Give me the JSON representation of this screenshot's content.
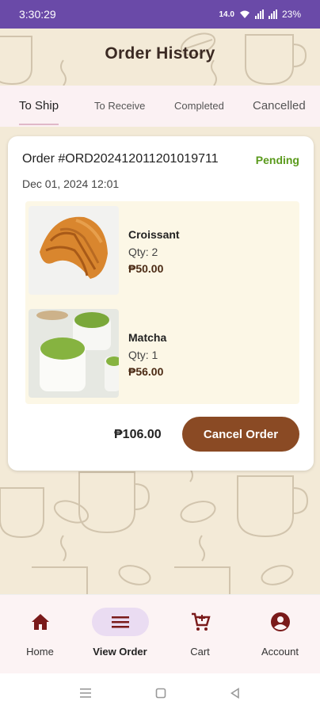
{
  "status_bar": {
    "time": "3:30:29",
    "network": "14.0",
    "battery": "23%"
  },
  "page": {
    "title": "Order History"
  },
  "tabs": [
    {
      "label": "To Ship"
    },
    {
      "label": "To Receive"
    },
    {
      "label": "Completed"
    },
    {
      "label": "Cancelled"
    }
  ],
  "order": {
    "id": "Order #ORD202412011201019711",
    "status": "Pending",
    "date": "Dec 01, 2024 12:01",
    "items": [
      {
        "name": "Croissant",
        "qty": "Qty: 2",
        "price": "₱50.00",
        "image": "croissant-photo"
      },
      {
        "name": "Matcha",
        "qty": "Qty: 1",
        "price": "₱56.00",
        "image": "matcha-photo"
      }
    ],
    "total": "₱106.00",
    "cancel_label": "Cancel Order"
  },
  "bottom_nav": [
    {
      "label": "Home",
      "icon": "home-icon"
    },
    {
      "label": "View Order",
      "icon": "menu-icon"
    },
    {
      "label": "Cart",
      "icon": "cart-icon"
    },
    {
      "label": "Account",
      "icon": "account-icon"
    }
  ],
  "colors": {
    "status_bar": "#6a4aa8",
    "accent_brown": "#8a4a24",
    "pending_green": "#5a9a1c",
    "icon_maroon": "#7a1a1a"
  }
}
